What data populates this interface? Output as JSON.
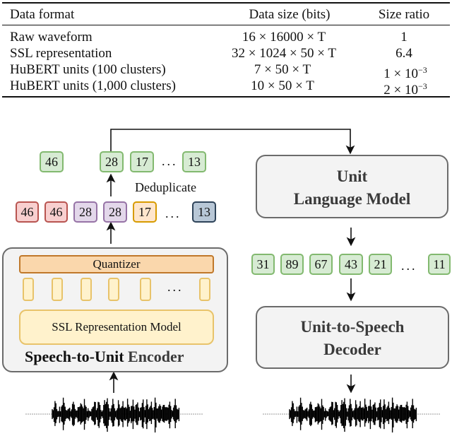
{
  "table": {
    "headers": [
      "Data format",
      "Data size (bits)",
      "Size ratio"
    ],
    "rows": [
      {
        "format": "Raw waveform",
        "size": "16 × 16000 × T",
        "ratio": "1",
        "ratio_exp": ""
      },
      {
        "format": "SSL representation",
        "size": "32 × 1024 × 50 × T",
        "ratio": "6.4",
        "ratio_exp": ""
      },
      {
        "format": "HuBERT units (100 clusters)",
        "size": "7 × 50 × T",
        "ratio": "1 × 10",
        "ratio_exp": "−3"
      },
      {
        "format": "HuBERT units (1,000 clusters)",
        "size": "10 × 50 × T",
        "ratio": "2 × 10",
        "ratio_exp": "−3"
      }
    ]
  },
  "diagram": {
    "deduplicated_units": [
      "46",
      "28",
      "17",
      "13"
    ],
    "raw_units": [
      "46",
      "46",
      "28",
      "28",
      "17",
      "13"
    ],
    "deduplicate_label": "Deduplicate",
    "ellipsis": "...",
    "encoder": {
      "quantizer_label": "Quantizer",
      "ssl_model_label": "SSL Representation Model",
      "title_part1": "Speech-to-Unit",
      "title_part2": "Encoder"
    },
    "ulm": {
      "line1": "Unit",
      "line2": "Language Model"
    },
    "generated_units": [
      "31",
      "89",
      "67",
      "43",
      "21",
      "11"
    ],
    "decoder": {
      "line1": "Unit-to-Speech",
      "line2": "Decoder"
    },
    "colors": {
      "unit_green": "#d7ebd3",
      "unit_red": "#f8cfcf",
      "unit_purple": "#e3d7ea",
      "unit_orange": "#ffe6cc",
      "unit_slate": "#b8c7d6",
      "block_gray": "#f3f3f3",
      "quantizer": "#fad7ac",
      "ssl": "#fff2cc"
    }
  }
}
